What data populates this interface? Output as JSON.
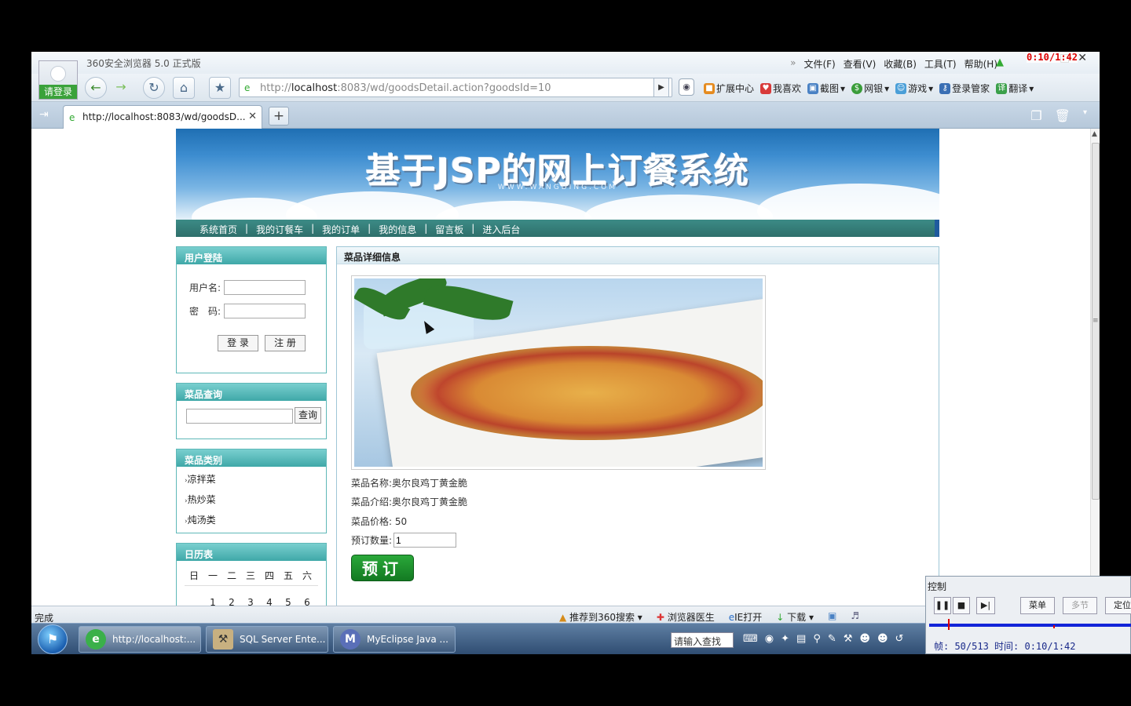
{
  "browser": {
    "app_title": "360安全浏览器 5.0 正式版",
    "login_label": "请登录",
    "menu": [
      "文件(F)",
      "查看(V)",
      "收藏(B)",
      "工具(T)",
      "帮助(H)"
    ],
    "timer": "0:10/1:42",
    "address": {
      "prefix": "http://",
      "host": "localhost",
      "rest": ":8083/wd/goodsDetail.action?goodsId=10"
    },
    "toolbar": [
      "扩展中心",
      "我喜欢",
      "截图",
      "网银",
      "游戏",
      "登录管家",
      "翻译"
    ],
    "tab_title": "http://localhost:8083/wd/goodsD...",
    "status_done": "完成",
    "status_items": [
      "推荐到360搜索",
      "浏览器医生",
      "IE打开",
      "下载"
    ]
  },
  "site": {
    "title": "基于JSP的网上订餐系统",
    "subtitle": "WWW.WANGDING.COM",
    "nav": [
      "系统首页",
      "我的订餐车",
      "我的订单",
      "我的信息",
      "留言板",
      "进入后台"
    ],
    "login_panel": {
      "title": "用户登陆",
      "username_label": "用户名:",
      "password_label": "密　码:",
      "login_button": "登 录",
      "register_button": "注 册"
    },
    "search_panel": {
      "title": "菜品查询",
      "button": "查询"
    },
    "category_panel": {
      "title": "菜品类别",
      "items": [
        "凉拌菜",
        "热炒菜",
        "炖汤类"
      ]
    },
    "calendar_panel": {
      "title": "日历表",
      "weekdays": [
        "日",
        "一",
        "二",
        "三",
        "四",
        "五",
        "六"
      ],
      "first_row": [
        "",
        "",
        "1",
        "2",
        "3",
        "4",
        "5",
        "6"
      ]
    },
    "detail": {
      "title": "菜品详细信息",
      "name_label": "菜品名称:",
      "name": "奥尔良鸡丁黄金脆",
      "intro_label": "菜品介绍:",
      "intro": "奥尔良鸡丁黄金脆",
      "price_label": "菜品价格:",
      "price": "50",
      "qty_label": "预订数量:",
      "qty_value": "1",
      "order_button": "预订"
    }
  },
  "taskbar": {
    "tasks": [
      "http://localhost:...",
      "SQL Server Ente...",
      "MyEclipse Java ..."
    ],
    "search_placeholder": "请输入查找"
  },
  "player": {
    "title": "控制",
    "menu_button": "菜单",
    "multi_button": "多节",
    "locate_button": "定位",
    "frame_text": "帧: 50/513 时间: 0:10/1:42"
  }
}
